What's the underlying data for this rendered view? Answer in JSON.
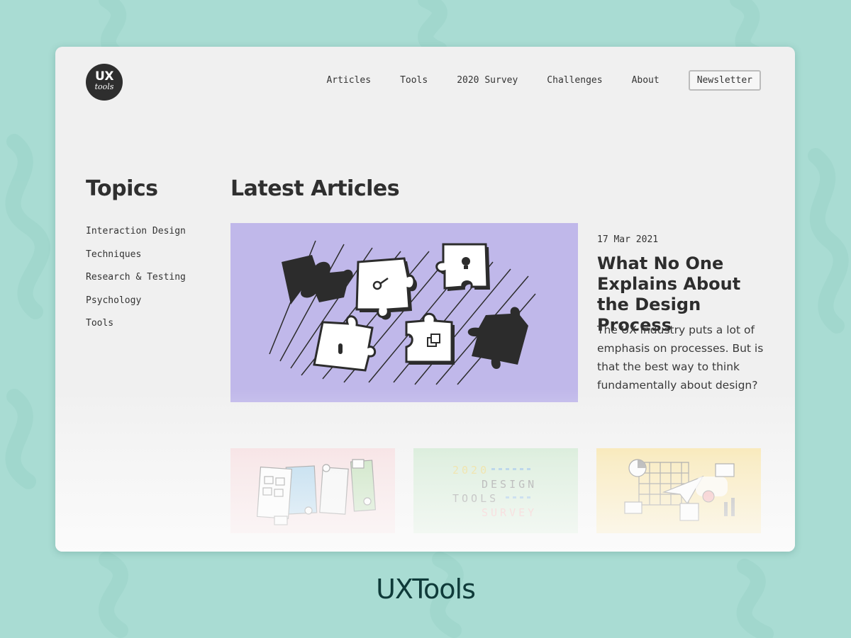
{
  "logo": {
    "line1": "UX",
    "line2": "tools"
  },
  "nav": {
    "items": [
      "Articles",
      "Tools",
      "2020 Survey",
      "Challenges",
      "About"
    ],
    "newsletter": "Newsletter"
  },
  "topics": {
    "title": "Topics",
    "items": [
      "Interaction Design",
      "Techniques",
      "Research & Testing",
      "Psychology",
      "Tools"
    ]
  },
  "latest": {
    "title": "Latest Articles",
    "featured": {
      "date": "17 Mar 2021",
      "headline": "What No One Explains About the Design Process",
      "excerpt": "The UX industry puts a lot of emphasis on processes. But is that the best way to think fundamentally about design?"
    },
    "thumb_survey": {
      "year": "2020",
      "w1": "DESIGN",
      "w2": "TOOLS",
      "w3": "SURVEY"
    }
  },
  "brand": "UXTools",
  "colors": {
    "background": "#a9dcd3",
    "card": "#f0f0f0",
    "hero": "#c0b8ea",
    "thumb_pink": "#f5d3d6",
    "thumb_green": "#c3e4c5",
    "thumb_yellow": "#f8dd8a",
    "brand_text": "#0f3a39"
  }
}
